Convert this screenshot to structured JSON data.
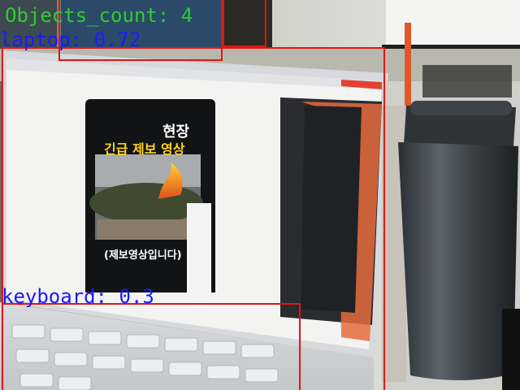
{
  "overlay": {
    "count_label": "Objects_count: 4",
    "detections": [
      {
        "label": "laptop: 0.72",
        "class": "laptop",
        "confidence": 0.72
      },
      {
        "label": "keyboard: 0.3",
        "class": "keyboard",
        "confidence": 0.3
      }
    ],
    "colors": {
      "box": "#e01616",
      "detection_text": "#1a1aff",
      "count_text": "#2ecc2e"
    }
  },
  "screen_content": {
    "video_title_line1": "현장",
    "video_title_line2": "긴급 제보 영상",
    "video_caption": "(제보영상입니다)"
  }
}
